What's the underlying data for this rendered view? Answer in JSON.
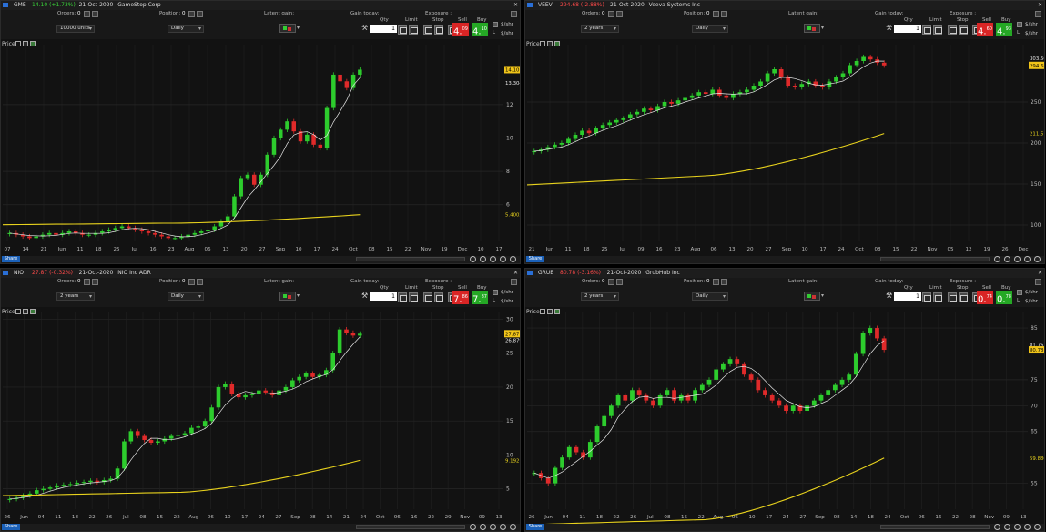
{
  "labels": {
    "orders": "Orders:",
    "position": "Position:",
    "latent_gain": "Latent gain:",
    "gain_today": "Gain today:",
    "exposure": "Exposure :",
    "qty": "Qty",
    "limit": "Limit",
    "stop": "Stop",
    "sell": "Sell",
    "buy": "Buy",
    "dollar_shr": "$/shr",
    "price": "Price",
    "share": "Share",
    "l_label": "L",
    "s_label": "S"
  },
  "panels": [
    {
      "id": "gme",
      "symbol": "GME",
      "price_change": "14.10 (+1.73%)",
      "date": "21-Oct-2020",
      "name": "GameStop Corp",
      "change_color": "#3ad13a",
      "orders": "0",
      "position": "0",
      "range": "10000 units",
      "interval": "Daily",
      "qty": "1",
      "sell_price": "4.09",
      "buy_price": "4.10",
      "sell_main": "4.",
      "sell_sup": "09",
      "buy_main": "4.",
      "buy_sup": "10",
      "chart_data": {
        "type": "candlestick",
        "x_ticks": [
          "07",
          "14",
          "21",
          "Jun",
          "11",
          "18",
          "25",
          "Jul",
          "16",
          "23",
          "Aug",
          "06",
          "13",
          "20",
          "27",
          "Sep",
          "10",
          "17",
          "24",
          "Oct",
          "08",
          "15",
          "22",
          "Nov",
          "19",
          "Dec",
          "10",
          "17"
        ],
        "y_ticks": [
          {
            "label": "12",
            "v": 12
          },
          {
            "label": "10",
            "v": 10
          },
          {
            "label": "8",
            "v": 8
          },
          {
            "label": "6",
            "v": 6
          }
        ],
        "ylim": [
          3.8,
          15.6
        ],
        "last_price": "14.10",
        "last_value": 14.1,
        "ma_label": "13.304",
        "ma_value": 13.304,
        "ma_long_label": "5.4002",
        "ma_long_value": 5.4002,
        "series_start": [
          4.3,
          4.2,
          4.1,
          4.0,
          4.1,
          4.2,
          4.3,
          4.2,
          4.3,
          4.4,
          4.3,
          4.2,
          4.2,
          4.3,
          4.4,
          4.5,
          4.6,
          4.7,
          4.6,
          4.5,
          4.4,
          4.3,
          4.2,
          4.1,
          4.0,
          4.0,
          4.1,
          4.2,
          4.3,
          4.4,
          4.5,
          4.7,
          5.0,
          5.3,
          6.5,
          7.6,
          7.8,
          7.2,
          7.8,
          9.0,
          10.0,
          10.5,
          11.0,
          10.4,
          9.8,
          10.2,
          9.6,
          9.4,
          11.8,
          13.8,
          13.4,
          13.0,
          13.8,
          14.1
        ],
        "ma_long_start": 4.8,
        "ma_long_dip": 4.9,
        "ma_long_end": 5.4
      }
    },
    {
      "id": "veev",
      "symbol": "VEEV",
      "price_change": "294.68 (-2.88%)",
      "date": "21-Oct-2020",
      "name": "Veeva Systems Inc",
      "change_color": "#ff4a4a",
      "orders": "0",
      "position": "0",
      "range": "2 years",
      "interval": "Daily",
      "qty": "1",
      "sell_main": "4.",
      "sell_sup": "60",
      "buy_main": "4.",
      "buy_sup": "93",
      "chart_data": {
        "type": "candlestick",
        "x_ticks": [
          "21",
          "Jun",
          "11",
          "18",
          "25",
          "Jul",
          "09",
          "16",
          "23",
          "Aug",
          "06",
          "13",
          "20",
          "27",
          "Sep",
          "10",
          "17",
          "24",
          "Oct",
          "08",
          "15",
          "22",
          "Nov",
          "05",
          "12",
          "19",
          "26",
          "Dec"
        ],
        "y_ticks": [
          {
            "label": "250",
            "v": 250
          },
          {
            "label": "200",
            "v": 200
          },
          {
            "label": "150",
            "v": 150
          },
          {
            "label": "100",
            "v": 100
          }
        ],
        "ylim": [
          80,
          320
        ],
        "last_price": "294.68",
        "last_value": 294.68,
        "ma_label": "303.50",
        "ma_value": 303.5,
        "ma_long_label": "211.51",
        "ma_long_value": 211.51,
        "series_start": [
          190,
          192,
          195,
          198,
          200,
          205,
          210,
          215,
          212,
          218,
          222,
          225,
          228,
          230,
          235,
          238,
          242,
          240,
          245,
          250,
          248,
          252,
          255,
          258,
          262,
          260,
          265,
          258,
          255,
          260,
          262,
          265,
          270,
          275,
          285,
          290,
          280,
          270,
          268,
          272,
          275,
          270,
          268,
          275,
          280,
          285,
          295,
          300,
          305,
          302,
          298,
          294.68
        ],
        "ma_long_start": 149,
        "ma_long_dip": 160,
        "ma_long_end": 211.51
      }
    },
    {
      "id": "nio",
      "symbol": "NIO",
      "price_change": "27.87 (-0.32%)",
      "date": "21-Oct-2020",
      "name": "NIO Inc ADR",
      "change_color": "#ff4a4a",
      "orders": "0",
      "position": "0",
      "range": "2 years",
      "interval": "Daily",
      "qty": "1",
      "sell_main": "7.",
      "sell_sup": "86",
      "buy_main": "7.",
      "buy_sup": "87",
      "chart_data": {
        "type": "candlestick",
        "x_ticks": [
          "26",
          "Jun",
          "04",
          "11",
          "18",
          "22",
          "26",
          "Jul",
          "08",
          "15",
          "22",
          "Aug",
          "06",
          "10",
          "17",
          "24",
          "27",
          "Sep",
          "08",
          "14",
          "21",
          "24",
          "Oct",
          "06",
          "16",
          "22",
          "29",
          "Nov",
          "09",
          "13"
        ],
        "y_ticks": [
          {
            "label": "30",
            "v": 30
          },
          {
            "label": "25",
            "v": 25
          },
          {
            "label": "20",
            "v": 20
          },
          {
            "label": "15",
            "v": 15
          },
          {
            "label": "10",
            "v": 10
          },
          {
            "label": "5",
            "v": 5
          }
        ],
        "ylim": [
          2,
          31
        ],
        "last_price": "27.87",
        "last_value": 27.87,
        "ma_label": "26.879",
        "ma_value": 26.879,
        "ma_long_label": "9.1921",
        "ma_long_value": 9.1921,
        "series_start": [
          3.5,
          3.7,
          4.0,
          4.3,
          4.8,
          5.0,
          5.2,
          5.5,
          5.6,
          5.7,
          5.9,
          6.0,
          6.2,
          6.0,
          6.3,
          6.5,
          8.0,
          12.0,
          13.5,
          12.8,
          12.2,
          11.8,
          12.0,
          12.4,
          12.8,
          13.0,
          13.2,
          14.0,
          14.2,
          15.0,
          17.0,
          20.0,
          20.5,
          19.0,
          18.5,
          18.8,
          19.0,
          19.5,
          19.2,
          18.8,
          19.5,
          20.0,
          21.0,
          21.5,
          22.0,
          21.5,
          21.8,
          22.5,
          25.0,
          28.5,
          28.0,
          27.6,
          27.87
        ],
        "ma_long_start": 4.0,
        "ma_long_dip": 4.5,
        "ma_long_end": 9.19
      }
    },
    {
      "id": "grub",
      "symbol": "GRUB",
      "price_change": "80.78 (-3.16%)",
      "date": "21-Oct-2020",
      "name": "GrubHub Inc",
      "change_color": "#ff4a4a",
      "orders": "0",
      "position": "0",
      "range": "2 years",
      "interval": "Daily",
      "qty": "1",
      "sell_main": "0.",
      "sell_sup": "74",
      "buy_main": "0.",
      "buy_sup": "78",
      "chart_data": {
        "type": "candlestick",
        "x_ticks": [
          "26",
          "Jun",
          "04",
          "11",
          "18",
          "22",
          "26",
          "Jul",
          "08",
          "15",
          "22",
          "Aug",
          "06",
          "10",
          "17",
          "24",
          "27",
          "Sep",
          "08",
          "14",
          "18",
          "24",
          "Oct",
          "06",
          "16",
          "22",
          "28",
          "Nov",
          "09",
          "13"
        ],
        "y_ticks": [
          {
            "label": "85",
            "v": 85
          },
          {
            "label": "75",
            "v": 75
          },
          {
            "label": "70",
            "v": 70
          },
          {
            "label": "65",
            "v": 65
          },
          {
            "label": "55",
            "v": 55
          }
        ],
        "ylim": [
          50,
          88
        ],
        "last_price": "80.78",
        "last_value": 80.78,
        "ma_label": "81.76",
        "ma_value": 81.76,
        "ma_long_label": "59.880",
        "ma_long_value": 59.88,
        "series_start": [
          57,
          56,
          55,
          58,
          60,
          62,
          61,
          60,
          63,
          66,
          68,
          70,
          72,
          71,
          73,
          72,
          71,
          70,
          72,
          73,
          71,
          72,
          71,
          73,
          74,
          75,
          77,
          78,
          79,
          78,
          76,
          75,
          73,
          72,
          71,
          70,
          69,
          70,
          69,
          70,
          71,
          72,
          73,
          74,
          75,
          76,
          80,
          84,
          85,
          83,
          80.78
        ],
        "ma_long_start": 47,
        "ma_long_dip": 48,
        "ma_long_end": 59.88
      }
    }
  ]
}
